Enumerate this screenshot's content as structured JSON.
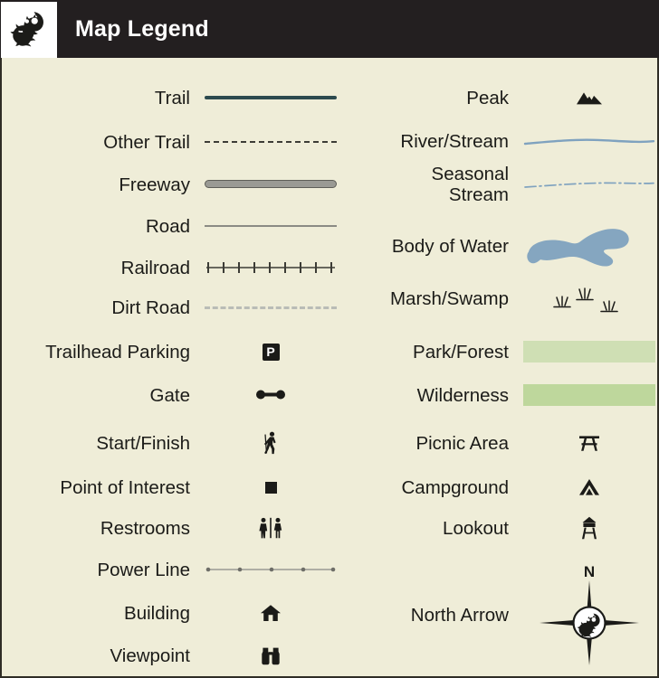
{
  "header": {
    "title": "Map Legend",
    "logo_icon": "ram-head-icon",
    "background_color": "#231f20",
    "text_color": "#ffffff"
  },
  "panel": {
    "background_color": "#efedd8",
    "border_color": "#2f2d26"
  },
  "colors": {
    "trail": "#2c4a4e",
    "other_trail": "#3c3c36",
    "freeway_fill": "#9a9a94",
    "freeway_casing": "#5e5e58",
    "road": "#8b8b84",
    "railroad": "#3c3c36",
    "dirt_road": "#b9bcb6",
    "water": "#85a6c0",
    "river": "#7fa2bf",
    "park_forest": "#cfdfb4",
    "wilderness": "#bed79c",
    "power_line": "#9a9a94",
    "symbol_black": "#1b1b18"
  },
  "left_column": [
    {
      "label": "Trail",
      "symbol": "solid-trail-line-icon"
    },
    {
      "label": "Other Trail",
      "symbol": "dashed-trail-line-icon"
    },
    {
      "label": "Freeway",
      "symbol": "freeway-line-icon"
    },
    {
      "label": "Road",
      "symbol": "road-line-icon"
    },
    {
      "label": "Railroad",
      "symbol": "railroad-line-icon"
    },
    {
      "label": "Dirt Road",
      "symbol": "dirt-road-line-icon"
    },
    {
      "label": "Trailhead Parking",
      "symbol": "parking-icon",
      "glyph_text": "P"
    },
    {
      "label": "Gate",
      "symbol": "gate-icon"
    },
    {
      "label": "Start/Finish",
      "symbol": "hiker-icon"
    },
    {
      "label": "Point of Interest",
      "symbol": "filled-square-icon"
    },
    {
      "label": "Restrooms",
      "symbol": "restrooms-icon"
    },
    {
      "label": "Power Line",
      "symbol": "power-line-icon"
    },
    {
      "label": "Building",
      "symbol": "house-icon"
    },
    {
      "label": "Viewpoint",
      "symbol": "binoculars-icon"
    }
  ],
  "right_column": [
    {
      "label": "Peak",
      "symbol": "peak-mountain-icon"
    },
    {
      "label": "River/Stream",
      "symbol": "river-line-icon"
    },
    {
      "label": "Seasonal\nStream",
      "symbol": "seasonal-stream-line-icon"
    },
    {
      "label": "Body of Water",
      "symbol": "water-body-icon"
    },
    {
      "label": "Marsh/Swamp",
      "symbol": "marsh-grass-icon"
    },
    {
      "label": "Park/Forest",
      "symbol": "park-forest-swatch"
    },
    {
      "label": "Wilderness",
      "symbol": "wilderness-swatch"
    },
    {
      "label": "Picnic Area",
      "symbol": "picnic-table-icon"
    },
    {
      "label": "Campground",
      "symbol": "tent-icon"
    },
    {
      "label": "Lookout",
      "symbol": "lookout-tower-icon"
    },
    {
      "label": "North Arrow",
      "symbol": "compass-rose-icon",
      "north_letter": "N"
    }
  ]
}
